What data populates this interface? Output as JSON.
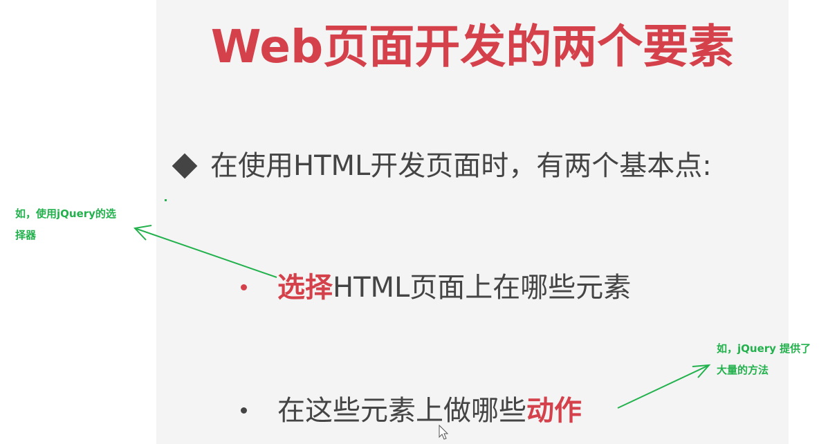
{
  "colors": {
    "accent_red": "#d5414b",
    "text_dark": "#444444",
    "annotation_green": "#22b14c",
    "slide_background": "#f4f4f4"
  },
  "slide": {
    "title": "Web页面开发的两个要素",
    "intro": "在使用HTML开发页面时，有两个基本点:",
    "bullet_1": {
      "highlight": "选择",
      "rest": "HTML页面上在哪些元素"
    },
    "bullet_2": {
      "rest": "在这些元素上做哪些",
      "highlight": "动作"
    }
  },
  "annotations": {
    "left_note": "如，使用jQuery的选\n择器",
    "right_note": "如，jQuery 提供了\n大量的方法"
  },
  "icons": {
    "intro_marker": "diamond-icon",
    "bullet_marker": "bullet-dot-icon",
    "annotation_pointer": "arrow-icon",
    "mouse_pointer": "cursor-icon"
  }
}
